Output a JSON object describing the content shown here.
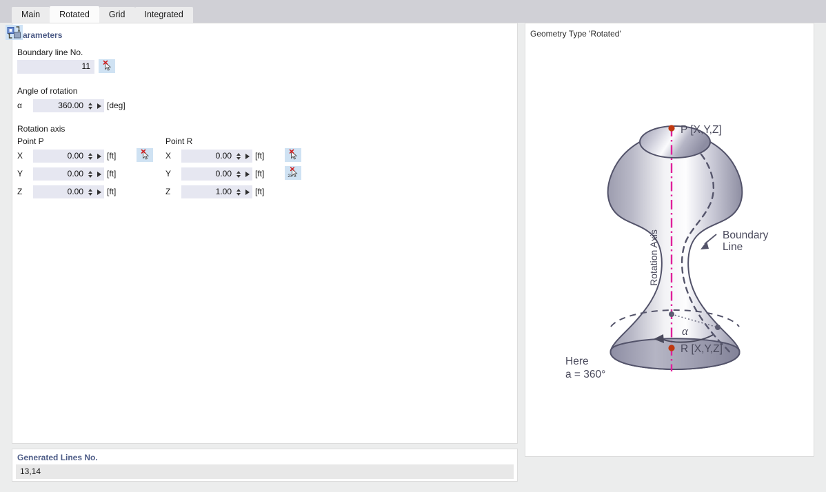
{
  "tabs": [
    {
      "label": "Main",
      "active": false
    },
    {
      "label": "Rotated",
      "active": true
    },
    {
      "label": "Grid",
      "active": false
    },
    {
      "label": "Integrated",
      "active": false
    }
  ],
  "parameters": {
    "section_title": "Parameters",
    "boundary_line": {
      "label": "Boundary line No.",
      "value": "11",
      "pick_button": "select-pick-icon"
    },
    "angle": {
      "label": "Angle of rotation",
      "symbol": "α",
      "value": "360.00",
      "unit": "[deg]"
    },
    "rotation_axis": {
      "label": "Rotation axis",
      "point_p": {
        "label": "Point P",
        "rows": [
          {
            "axis": "X",
            "value": "0.00",
            "unit": "[ft]"
          },
          {
            "axis": "Y",
            "value": "0.00",
            "unit": "[ft]"
          },
          {
            "axis": "Z",
            "value": "0.00",
            "unit": "[ft]"
          }
        ],
        "pick_button": "select-pick-icon"
      },
      "point_r": {
        "label": "Point R",
        "rows": [
          {
            "axis": "X",
            "value": "0.00",
            "unit": "[ft]"
          },
          {
            "axis": "Y",
            "value": "0.00",
            "unit": "[ft]"
          },
          {
            "axis": "Z",
            "value": "1.00",
            "unit": "[ft]"
          }
        ],
        "pick_button": "select-pick-icon",
        "pick_button_2": "select-two-points-pick-icon",
        "pick_button_2_badge": "2x"
      }
    }
  },
  "generated_lines": {
    "label": "Generated Lines No.",
    "value": "13,14"
  },
  "preview": {
    "title": "Geometry Type 'Rotated'",
    "labels": {
      "point_p": "P [X,Y,Z]",
      "point_r": "R [X,Y,Z]",
      "rotation_axis": "Rotation Axis",
      "boundary_line_1": "Boundary",
      "boundary_line_2": "Line",
      "alpha": "α",
      "note_line_1": "Here",
      "note_line_2": "a = 360°"
    }
  },
  "bottom_toolbar": {
    "export_button": "transfer-objects-icon"
  },
  "colors": {
    "accent": "#4c5b86",
    "field_bg": "#e6e7f1",
    "pick_button_bg": "#cfe2f3",
    "axis_line": "#e0219b",
    "point_marker": "#c03a10",
    "diagram_outline": "#55556b",
    "window_bg": "#d0d0d6"
  }
}
